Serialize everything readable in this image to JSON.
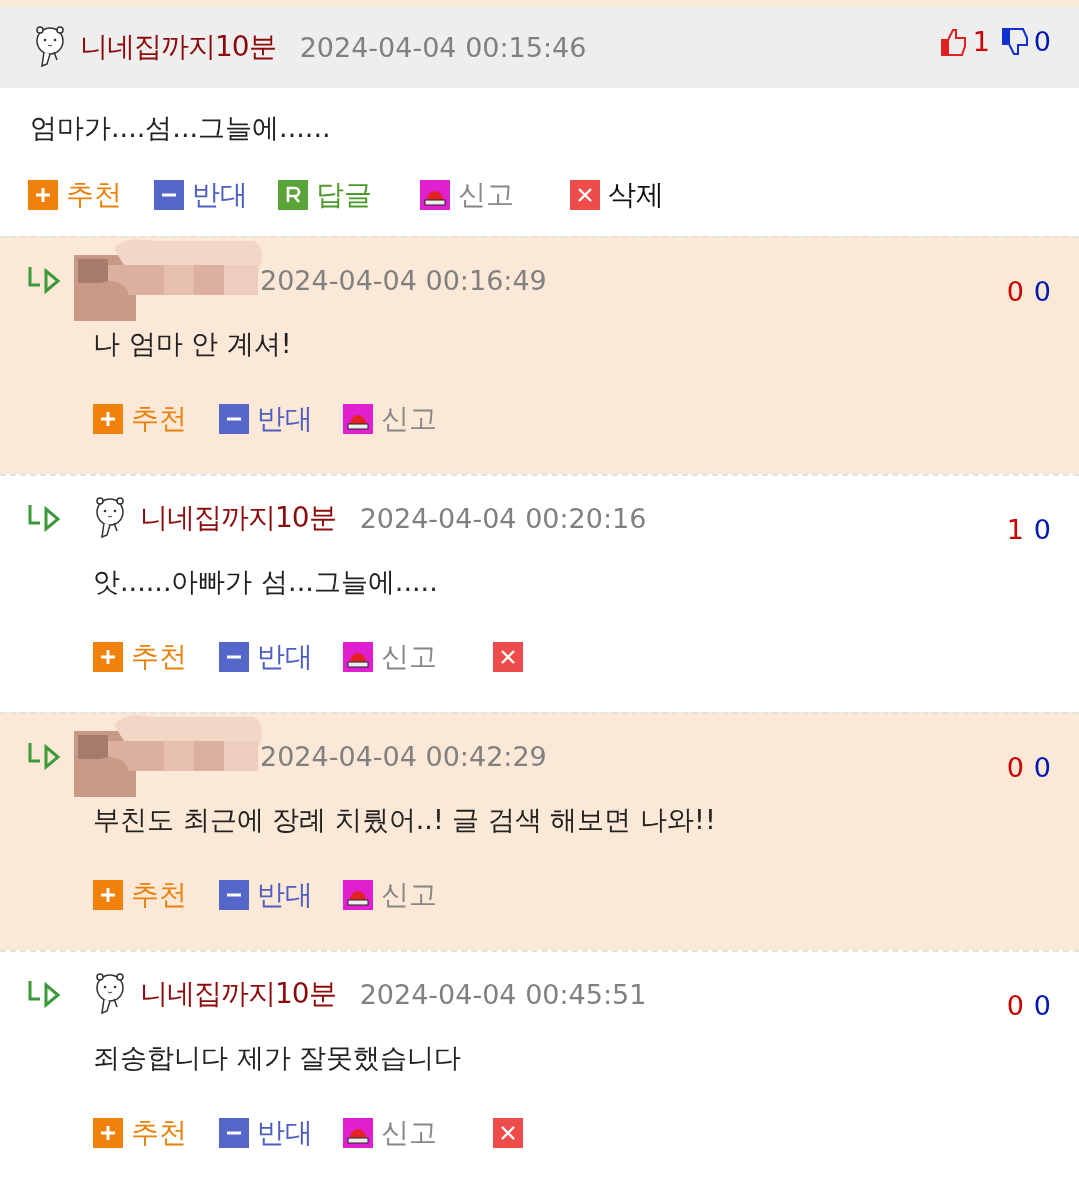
{
  "comment": {
    "author": "니네집까지10분",
    "time": "2024-04-04 00:15:46",
    "likes": "1",
    "dislikes": "0",
    "text": "엄마가....섬...그늘에......",
    "actions": [
      {
        "kind": "recommend",
        "label": "추천"
      },
      {
        "kind": "oppose",
        "label": "반대"
      },
      {
        "kind": "reply",
        "label": "답글"
      },
      {
        "kind": "report",
        "label": "신고"
      },
      {
        "kind": "delete",
        "label": "삭제"
      }
    ]
  },
  "replies": [
    {
      "highlighted": true,
      "kind": "picture",
      "time": "2024-04-04 00:16:49",
      "likes": "0",
      "dislikes": "0",
      "text": "나 엄마 안 계셔!",
      "actions": [
        {
          "kind": "recommend",
          "label": "추천"
        },
        {
          "kind": "oppose",
          "label": "반대"
        },
        {
          "kind": "report",
          "label": "신고"
        }
      ]
    },
    {
      "highlighted": false,
      "author": "니네집까지10분",
      "time": "2024-04-04 00:20:16",
      "likes": "1",
      "dislikes": "0",
      "text": "앗......아빠가 섬...그늘에.....",
      "actions": [
        {
          "kind": "recommend",
          "label": "추천"
        },
        {
          "kind": "oppose",
          "label": "반대"
        },
        {
          "kind": "report",
          "label": "신고"
        },
        {
          "kind": "delete"
        }
      ]
    },
    {
      "highlighted": true,
      "kind": "picture",
      "time": "2024-04-04 00:42:29",
      "likes": "0",
      "dislikes": "0",
      "text": "부친도 최근에 장례 치뤘어..! 글 검색 해보면 나와!!",
      "actions": [
        {
          "kind": "recommend",
          "label": "추천"
        },
        {
          "kind": "oppose",
          "label": "반대"
        },
        {
          "kind": "report",
          "label": "신고"
        }
      ]
    },
    {
      "highlighted": false,
      "author": "니네집까지10분",
      "time": "2024-04-04 00:45:51",
      "likes": "0",
      "dislikes": "0",
      "text": "죄송합니다 제가 잘못했습니다",
      "actions": [
        {
          "kind": "recommend",
          "label": "추천"
        },
        {
          "kind": "oppose",
          "label": "반대"
        },
        {
          "kind": "report",
          "label": "신고"
        },
        {
          "kind": "delete"
        }
      ]
    }
  ]
}
